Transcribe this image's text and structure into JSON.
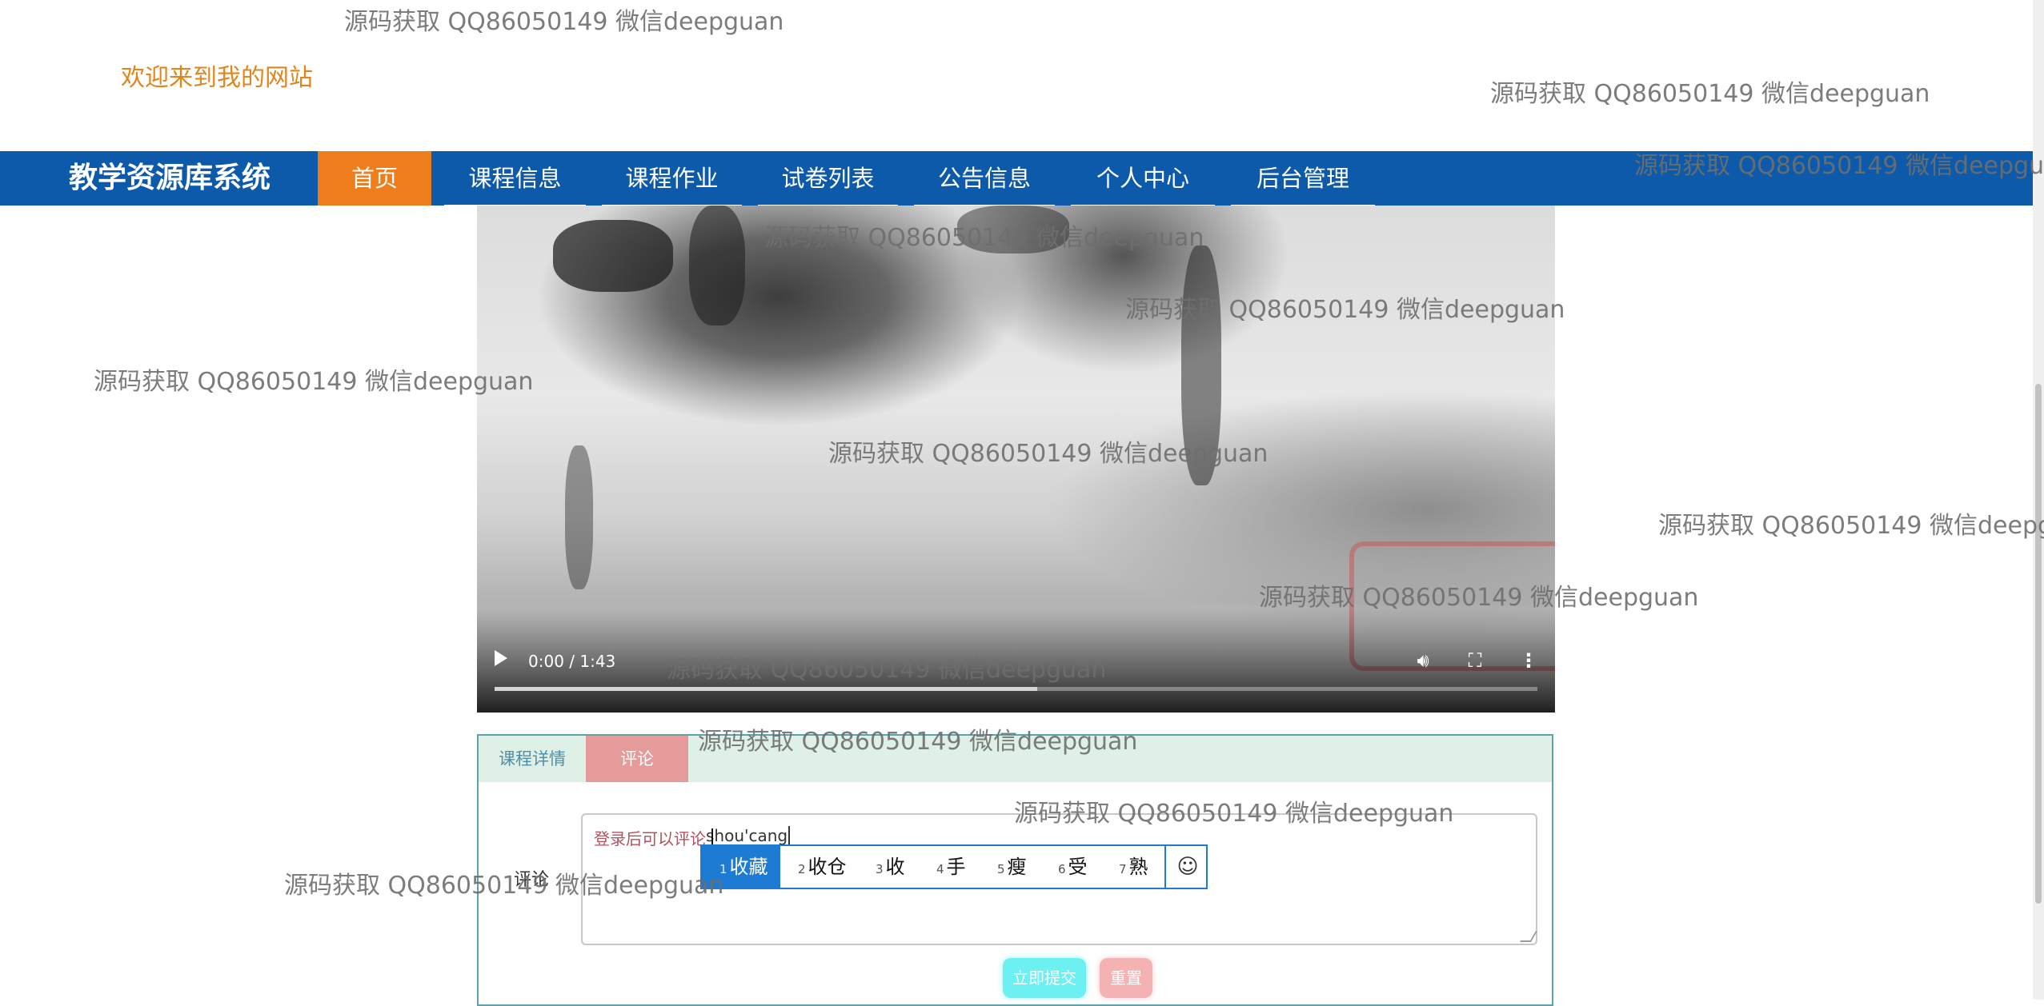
{
  "header": {
    "welcome_text": "欢迎来到我的网站"
  },
  "nav": {
    "brand": "教学资源库系统",
    "items": [
      {
        "label": "首页",
        "active": true
      },
      {
        "label": "课程信息"
      },
      {
        "label": "课程作业"
      },
      {
        "label": "试卷列表"
      },
      {
        "label": "公告信息"
      },
      {
        "label": "个人中心"
      },
      {
        "label": "后台管理"
      }
    ]
  },
  "video": {
    "time": "0:00 / 1:43",
    "progress": 0.52
  },
  "tabs": {
    "details": "课程详情",
    "comments": "评论"
  },
  "comment": {
    "label": "评论",
    "placeholder": "登录后可以评论",
    "typed": "shou'cang",
    "submit": "立即提交",
    "reset": "重置"
  },
  "ime": {
    "candidates": [
      {
        "num": "1",
        "text": "收藏"
      },
      {
        "num": "2",
        "text": "收仓"
      },
      {
        "num": "3",
        "text": "收"
      },
      {
        "num": "4",
        "text": "手"
      },
      {
        "num": "5",
        "text": "瘦"
      },
      {
        "num": "6",
        "text": "受"
      },
      {
        "num": "7",
        "text": "熟"
      }
    ],
    "emoji_icon": "☺"
  },
  "watermark_text": "源码获取 QQ86050149 微信deepguan",
  "colors": {
    "nav": "#0e5aaa",
    "nav_active": "#ee7d1c",
    "welcome": "#e0861c",
    "ime_select": "#1e7bd3"
  }
}
